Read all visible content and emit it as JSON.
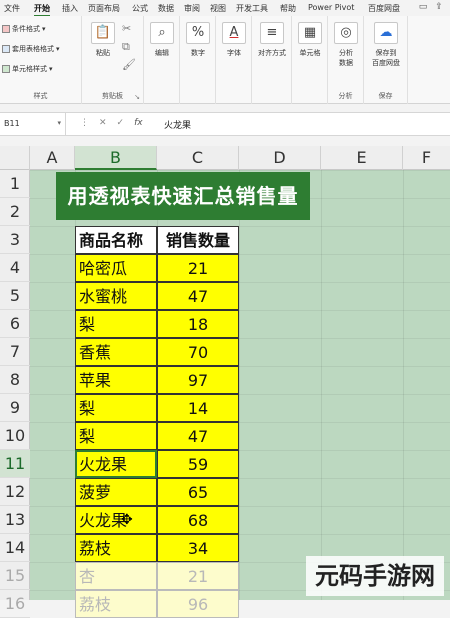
{
  "menu": {
    "tabs": [
      "文件",
      "开始",
      "插入",
      "页面布局",
      "公式",
      "数据",
      "审阅",
      "视图",
      "开发工具",
      "帮助",
      "Power Pivot",
      "百度网盘"
    ],
    "active_tab": "开始"
  },
  "ribbon": {
    "styles": {
      "conditional_format": "条件格式",
      "table_format": "套用表格格式",
      "cell_styles": "单元格样式",
      "label": "样式"
    },
    "clipboard": {
      "paste": "粘贴",
      "label": "剪贴板",
      "launcher": "↘"
    },
    "edit": {
      "label": "编辑"
    },
    "number": {
      "label": "数字",
      "icon_text": "%"
    },
    "font": {
      "label": "字体",
      "icon_text": "A"
    },
    "alignment": {
      "label": "对齐方式"
    },
    "cells": {
      "label": "单元格"
    },
    "analysis": {
      "label": "分析",
      "analyze_data": "分析\n数据"
    },
    "save": {
      "label": "保存",
      "save_to_netdisk": "保存到\n百度网盘"
    }
  },
  "formula_bar": {
    "cell_ref": "B11",
    "fx": "fx",
    "value": "火龙果"
  },
  "columns": [
    "A",
    "B",
    "C",
    "D",
    "E",
    "F"
  ],
  "selected_column": "B",
  "rows": [
    "1",
    "2",
    "3",
    "4",
    "5",
    "6",
    "7",
    "8",
    "9",
    "10",
    "11",
    "12",
    "13",
    "14",
    "15",
    "16"
  ],
  "selected_row": "11",
  "sheet": {
    "banner_title": "用透视表快速汇总销售量",
    "table_header": {
      "name": "商品名称",
      "qty": "销售数量"
    },
    "table_rows": [
      {
        "name": "哈密瓜",
        "qty": "21"
      },
      {
        "name": "水蜜桃",
        "qty": "47"
      },
      {
        "name": "梨",
        "qty": "18"
      },
      {
        "name": "香蕉",
        "qty": "70"
      },
      {
        "name": "苹果",
        "qty": "97"
      },
      {
        "name": "梨",
        "qty": "14"
      },
      {
        "name": "梨",
        "qty": "47"
      },
      {
        "name": "火龙果",
        "qty": "59"
      },
      {
        "name": "菠萝",
        "qty": "65"
      },
      {
        "name": "火龙果",
        "qty": "68"
      },
      {
        "name": "荔枝",
        "qty": "34"
      },
      {
        "name": "杏",
        "qty": "21"
      },
      {
        "name": "荔枝",
        "qty": "96"
      }
    ],
    "active_row_index": 7
  },
  "watermark": "元码手游网"
}
